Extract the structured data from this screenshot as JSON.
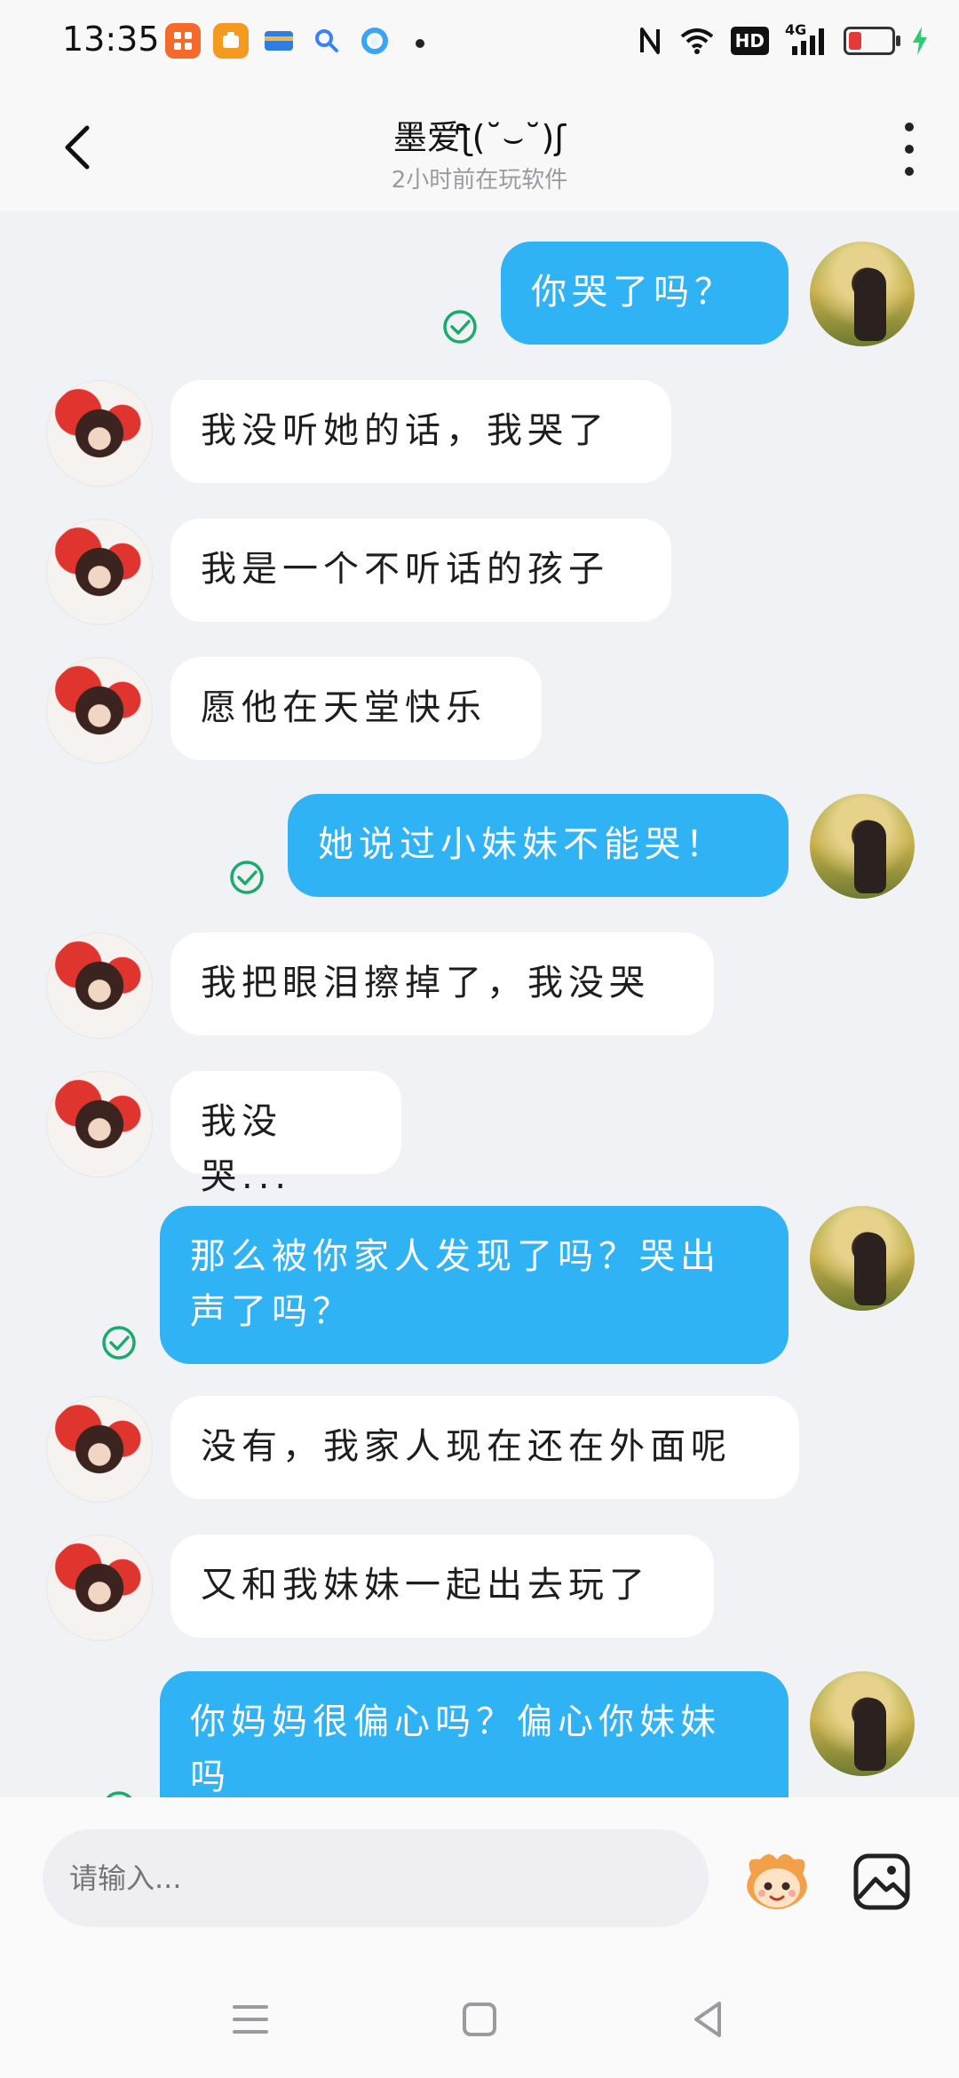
{
  "status_bar": {
    "time": "13:35",
    "app_icons": [
      {
        "icon": "app-orange-grid-icon",
        "color": "#f26b2a"
      },
      {
        "icon": "app-orange-box-icon",
        "color": "#f39a1f"
      },
      {
        "icon": "app-card-icon",
        "color": "#2f7de1"
      },
      {
        "icon": "app-search-icon",
        "color": "#3b82f6"
      },
      {
        "icon": "app-ring-icon",
        "color": "#3ba5f5"
      }
    ],
    "indicators": [
      "nfc-icon",
      "wifi-icon",
      "hd-icon",
      "4g-signal-icon",
      "battery-icon",
      "charging-icon"
    ],
    "hd_label": "HD",
    "network_label": "4G"
  },
  "header": {
    "title": "墨爱ƪ(˘⌣˘)ʃ",
    "subtitle": "2小时前在玩软件"
  },
  "messages": [
    {
      "side": "out",
      "text": "你哭了吗？",
      "read": true
    },
    {
      "side": "in",
      "text": "我没听她的话，我哭了"
    },
    {
      "side": "in",
      "text": "我是一个不听话的孩子"
    },
    {
      "side": "in",
      "text": "愿他在天堂快乐"
    },
    {
      "side": "out",
      "text": "她说过小妹妹不能哭！",
      "read": true
    },
    {
      "side": "in",
      "text": "我把眼泪擦掉了，我没哭"
    },
    {
      "side": "in",
      "text": "我没哭..."
    },
    {
      "side": "out",
      "text": "那么被你家人发现了吗？哭出声了吗？",
      "read": true
    },
    {
      "side": "in",
      "text": "没有，我家人现在还在外面呢"
    },
    {
      "side": "in",
      "text": "又和我妹妹一起出去玩了"
    },
    {
      "side": "out",
      "text": "你妈妈很偏心吗？偏心你妹妹吗",
      "read": true
    }
  ],
  "input": {
    "placeholder": "请输入..."
  },
  "colors": {
    "outgoing_bubble": "#2fb3f5",
    "incoming_bubble": "#ffffff",
    "read_check": "#1aab6b",
    "background": "#f1f2f6"
  }
}
